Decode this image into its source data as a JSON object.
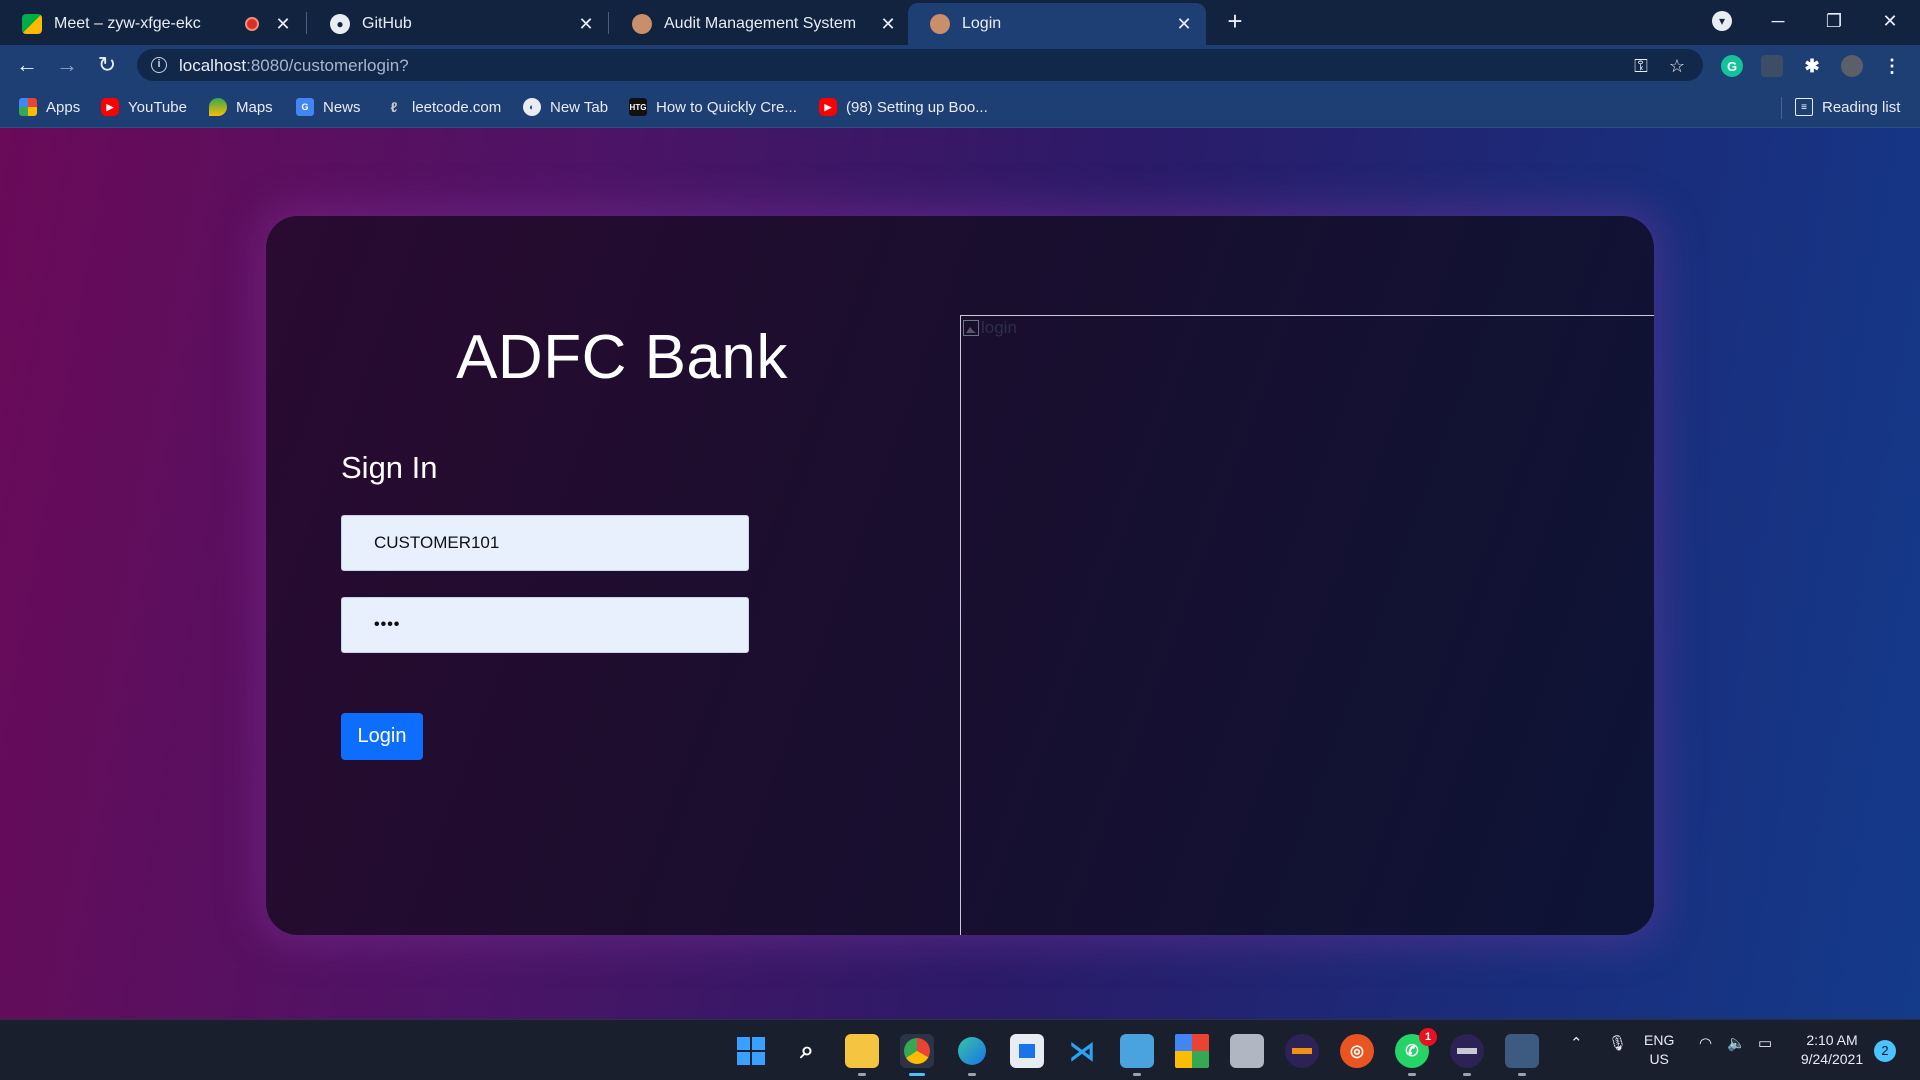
{
  "browser": {
    "tabs": [
      {
        "title": "Meet – zyw-xfge-ekc",
        "icon": "google-meet-icon",
        "recording": true
      },
      {
        "title": "GitHub",
        "icon": "github-icon"
      },
      {
        "title": "Audit Management System",
        "icon": "avatar-favicon-icon"
      },
      {
        "title": "Login",
        "icon": "avatar-favicon-icon",
        "active": true
      }
    ],
    "new_tab": "+",
    "url_host": "localhost",
    "url_rest": ":8080/customerlogin?",
    "bookmarks": [
      {
        "label": "Apps",
        "icon": "apps-grid-icon"
      },
      {
        "label": "YouTube",
        "icon": "youtube-icon"
      },
      {
        "label": "Maps",
        "icon": "maps-icon"
      },
      {
        "label": "News",
        "icon": "news-icon"
      },
      {
        "label": "leetcode.com",
        "icon": "leetcode-icon"
      },
      {
        "label": "New Tab",
        "icon": "globe-icon"
      },
      {
        "label": "How to Quickly Cre...",
        "icon": "htg-icon",
        "icon_text": "HTG"
      },
      {
        "label": "(98) Setting up Boo...",
        "icon": "youtube-icon"
      }
    ],
    "reading_list": "Reading list"
  },
  "login_page": {
    "brand": "ADFC Bank",
    "heading": "Sign In",
    "username_value": "CUSTOMER101",
    "password_mask": "••••",
    "login_button": "Login",
    "image_alt": "login"
  },
  "taskbar": {
    "language": "ENG",
    "region": "US",
    "time": "2:10 AM",
    "date": "9/24/2021",
    "notification_count": "2",
    "whatsapp_badge": "1"
  },
  "colors": {
    "login_button": "#0d6efd",
    "input_bg": "#e8f0fe",
    "active_tab": "#1d3f73"
  }
}
